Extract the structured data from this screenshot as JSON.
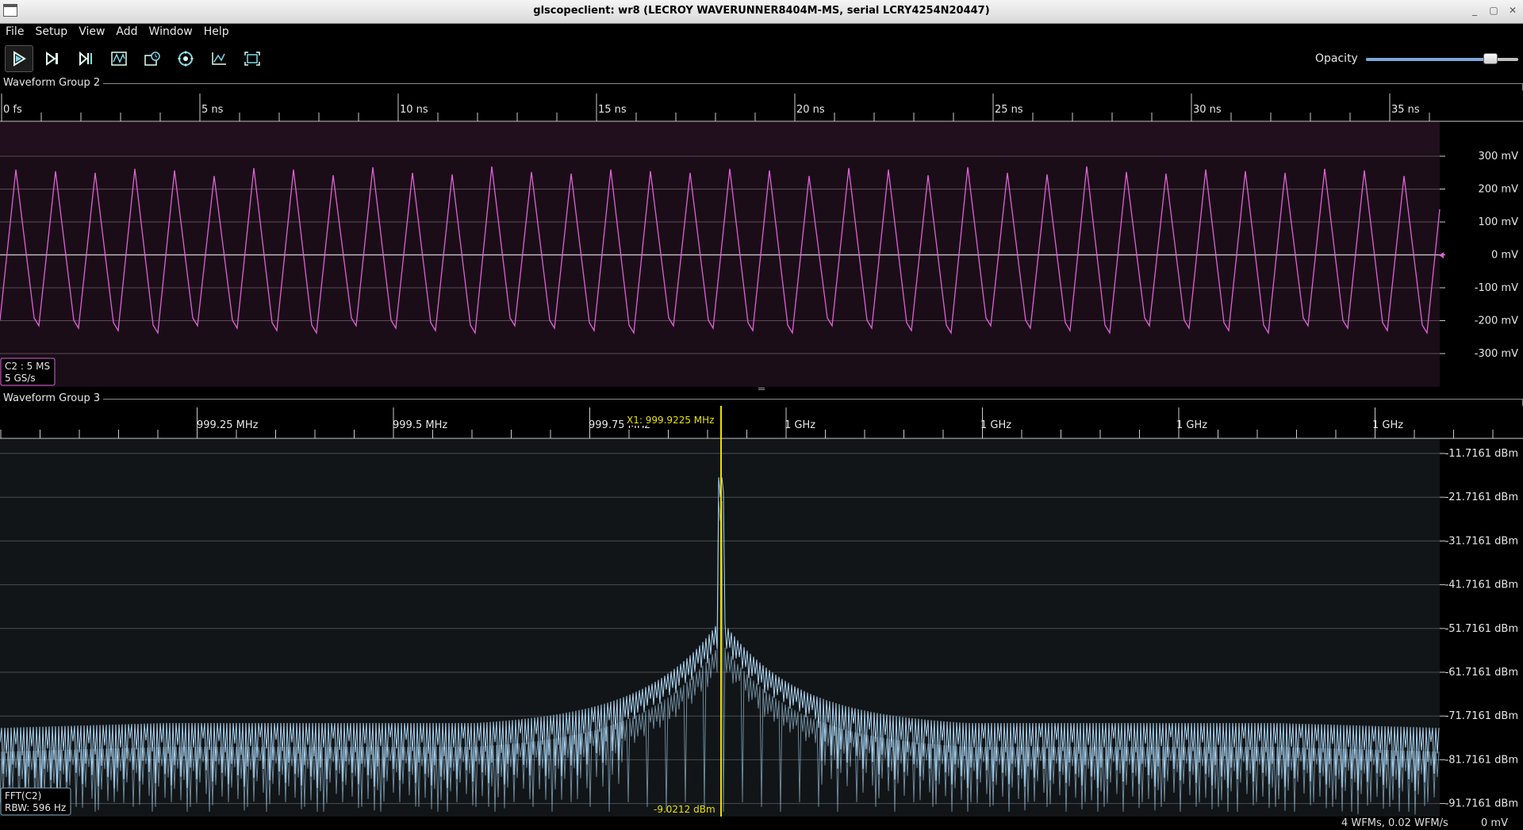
{
  "window": {
    "title": "glscopeclient: wr8 (LECROY WAVERUNNER8404M-MS, serial LCRY4254N20447)"
  },
  "menu": [
    "File",
    "Setup",
    "View",
    "Add",
    "Window",
    "Help"
  ],
  "toolbar": {
    "buttons": [
      "play-icon",
      "step-icon",
      "single-icon",
      "waveform-icon",
      "history-icon",
      "target-icon",
      "axis-icon",
      "zoom-fit-icon"
    ],
    "opacity_label": "Opacity",
    "opacity_value": 0.82
  },
  "group2": {
    "label": "Waveform Group 2",
    "time_ticks": [
      "0 fs",
      "5 ns",
      "10 ns",
      "15 ns",
      "20 ns",
      "25 ns",
      "30 ns",
      "35 ns"
    ],
    "volt_ticks": [
      "300 mV",
      "200 mV",
      "100 mV",
      "0 mV",
      "-100 mV",
      "-200 mV",
      "-300 mV"
    ],
    "channel_info": {
      "line1": "C2 : 5 MS",
      "line2": "5 GS/s"
    },
    "trace_color": "#e060d8"
  },
  "group3": {
    "label": "Waveform Group 3",
    "freq_ticks": [
      "999.25 MHz",
      "999.5 MHz",
      "999.75 MHz",
      "1 GHz",
      "1 GHz",
      "1 GHz",
      "1 GHz"
    ],
    "dbm_ticks": [
      "-11.7161 dBm",
      "-21.7161 dBm",
      "-31.7161 dBm",
      "-41.7161 dBm",
      "-51.7161 dBm",
      "-61.7161 dBm",
      "-71.7161 dBm",
      "-81.7161 dBm",
      "-91.7161 dBm"
    ],
    "cursor_label": "X1: 999.9225 MHz",
    "cursor_value": "-9.0212 dBm",
    "cursor_color": "#e8e000",
    "trace_color": "#a9d4f2",
    "channel_info": {
      "line1": "FFT(C2)",
      "line2": "RBW: 596 Hz"
    }
  },
  "status": {
    "wfms": "4 WFMs, 0.02 WFM/s",
    "value": "0 mV"
  }
}
